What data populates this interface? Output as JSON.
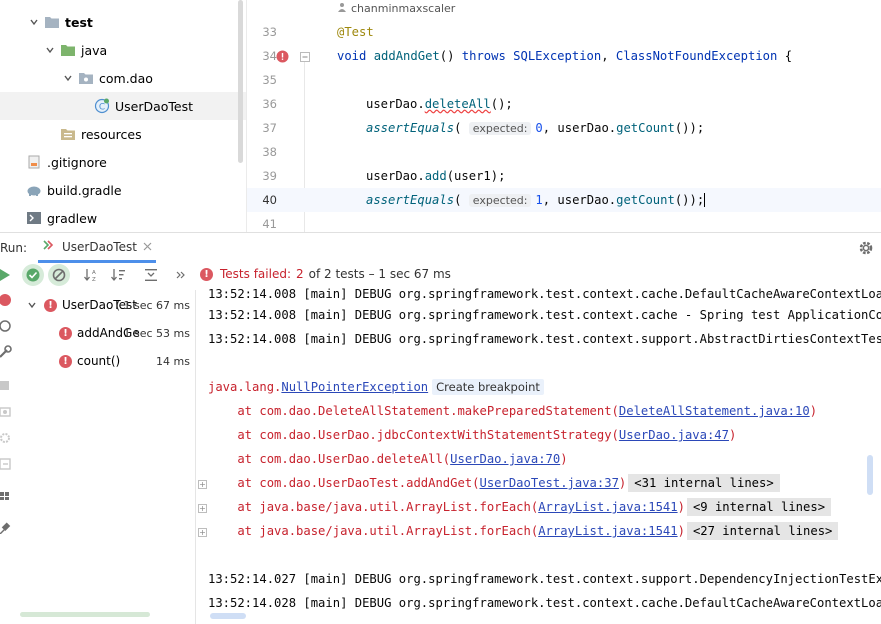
{
  "project_tree": {
    "items": [
      {
        "label": "test",
        "bold": true
      },
      {
        "label": "java"
      },
      {
        "label": "com.dao"
      },
      {
        "label": "UserDaoTest"
      },
      {
        "label": "resources"
      },
      {
        "label": ".gitignore"
      },
      {
        "label": "build.gradle"
      },
      {
        "label": "gradlew"
      }
    ]
  },
  "editor": {
    "author": "chanminmaxscaler",
    "line_numbers": [
      "33",
      "34",
      "35",
      "36",
      "37",
      "38",
      "39",
      "40",
      "41"
    ],
    "annotation": "@Test",
    "sig_void": "void",
    "sig_method": "addAndGet",
    "sig_parens": "()",
    "sig_throws": "throws",
    "sig_exc1": "SQLException",
    "sig_comma": ",",
    "sig_exc2": "ClassNotFoundException",
    "sig_brace": "{",
    "l36_obj": "userDao.",
    "l36_call": "deleteAll",
    "l36_end": "();",
    "l37_call": "assertEquals",
    "l37_open": "(",
    "l37_hint": "expected:",
    "l37_num": "0",
    "l37_mid": ", userDao.",
    "l37_call2": "getCount",
    "l37_end": "());",
    "l39_obj": "userDao.",
    "l39_call": "add",
    "l39_end": "(user1);",
    "l40_call": "assertEquals",
    "l40_open": "(",
    "l40_hint": "expected:",
    "l40_num": "1",
    "l40_mid": ", userDao.",
    "l40_call2": "getCount",
    "l40_end": "());"
  },
  "run_window": {
    "label": "Run:",
    "tab_title": "UserDaoTest"
  },
  "test_toolbar": {
    "status_failed": "Tests failed:",
    "status_count": "2",
    "status_rest": "of 2 tests – 1 sec 67 ms"
  },
  "test_tree": {
    "root": {
      "label": "UserDaoTest",
      "duration": "( 1 sec 67 ms"
    },
    "children": [
      {
        "label": "addAndGe",
        "duration": "1 sec 53 ms"
      },
      {
        "label": "count()",
        "duration": "14 ms"
      }
    ]
  },
  "console": {
    "log1": "13:52:14.008 [main] DEBUG org.springframework.test.context.cache.DefaultCacheAwareContextLoade",
    "log2": "13:52:14.008 [main] DEBUG org.springframework.test.context.cache - Spring test ApplicationCont",
    "log3": "13:52:14.008 [main] DEBUG org.springframework.test.context.support.AbstractDirtiesContextTestE",
    "exc_prefix": "java.lang.",
    "exc_name": "NullPointerException",
    "create_breakpoint": "Create breakpoint",
    "st1_pre": "    at com.dao.DeleteAllStatement.makePreparedStatement(",
    "st1_link": "DeleteAllStatement.java:10",
    "st1_post": ")",
    "st2_pre": "    at com.dao.UserDao.jdbcContextWithStatementStrategy(",
    "st2_link": "UserDao.java:47",
    "st2_post": ")",
    "st3_pre": "    at com.dao.UserDao.deleteAll(",
    "st3_link": "UserDao.java:70",
    "st3_post": ")",
    "st4_pre": "    at com.dao.UserDaoTest.addAndGet(",
    "st4_link": "UserDaoTest.java:37",
    "st4_post": ")",
    "st4_internal": "<31 internal lines>",
    "st5_pre": "    at java.base/java.util.ArrayList.forEach(",
    "st5_link": "ArrayList.java:1541",
    "st5_post": ")",
    "st5_internal": "<9 internal lines>",
    "st6_pre": "    at java.base/java.util.ArrayList.forEach(",
    "st6_link": "ArrayList.java:1541",
    "st6_post": ")",
    "st6_internal": "<27 internal lines>",
    "log4": "13:52:14.027 [main] DEBUG org.springframework.test.context.support.DependencyInjectionTestExec",
    "log5": "13:52:14.028 [main] DEBUG org.springframework.test.context.cache.DefaultCacheAwareContextLoade"
  },
  "colors": {
    "error_red": "#c7222d",
    "link_blue": "#2b48b8",
    "success_green": "#59a869",
    "folder_blue": "#7e9bb8",
    "folder_green": "#7db46c"
  }
}
